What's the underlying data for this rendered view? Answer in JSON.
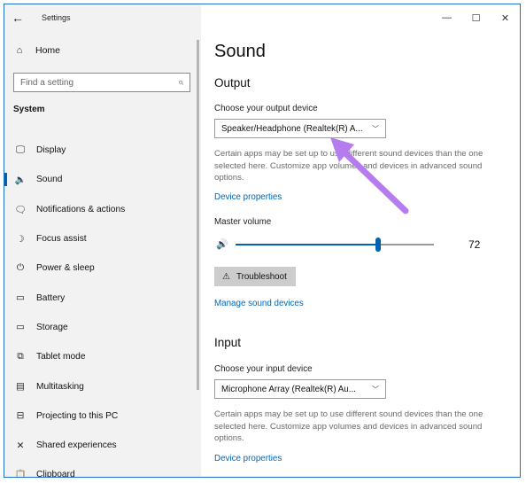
{
  "window": {
    "title": "Settings",
    "back_icon": "back-arrow-icon",
    "controls": {
      "minimize": "—",
      "maximize": "☐",
      "close": "✕"
    }
  },
  "sidebar": {
    "home": {
      "label": "Home",
      "icon": "home-icon"
    },
    "search": {
      "placeholder": "Find a setting",
      "icon": "search-icon"
    },
    "section": "System",
    "items": [
      {
        "label": "Display",
        "icon": "monitor-icon",
        "glyph": "🖵"
      },
      {
        "label": "Sound",
        "icon": "speaker-icon",
        "glyph": "🔈",
        "active": true
      },
      {
        "label": "Notifications & actions",
        "icon": "notification-icon",
        "glyph": "🗨"
      },
      {
        "label": "Focus assist",
        "icon": "moon-icon",
        "glyph": "☽"
      },
      {
        "label": "Power & sleep",
        "icon": "power-icon",
        "glyph": "⏻"
      },
      {
        "label": "Battery",
        "icon": "battery-icon",
        "glyph": "▭"
      },
      {
        "label": "Storage",
        "icon": "storage-icon",
        "glyph": "▭"
      },
      {
        "label": "Tablet mode",
        "icon": "tablet-mode-icon",
        "glyph": "⧉"
      },
      {
        "label": "Multitasking",
        "icon": "multitasking-icon",
        "glyph": "▤"
      },
      {
        "label": "Projecting to this PC",
        "icon": "projecting-icon",
        "glyph": "⊟"
      },
      {
        "label": "Shared experiences",
        "icon": "shared-experiences-icon",
        "glyph": "✕"
      },
      {
        "label": "Clipboard",
        "icon": "clipboard-icon",
        "glyph": "📋"
      }
    ]
  },
  "main": {
    "title": "Sound",
    "output": {
      "heading": "Output",
      "device_label": "Choose your output device",
      "device_value": "Speaker/Headphone (Realtek(R) A...",
      "description": "Certain apps may be set up to use different sound devices than the one selected here. Customize app volumes and devices in advanced sound options.",
      "device_properties_link": "Device properties",
      "master_volume_label": "Master volume",
      "volume_icon": "speaker-volume-icon",
      "volume_value": "72",
      "volume_level": 0.72,
      "troubleshoot_label": "Troubleshoot",
      "troubleshoot_icon": "warning-icon",
      "manage_link": "Manage sound devices"
    },
    "input": {
      "heading": "Input",
      "device_label": "Choose your input device",
      "device_value": "Microphone Array (Realtek(R) Au...",
      "description": "Certain apps may be set up to use different sound devices than the one selected here. Customize app volumes and devices in advanced sound options.",
      "device_properties_link": "Device properties"
    }
  },
  "annotation": {
    "arrow_color": "#b57cf0",
    "icon": "pointer-arrow-icon"
  }
}
